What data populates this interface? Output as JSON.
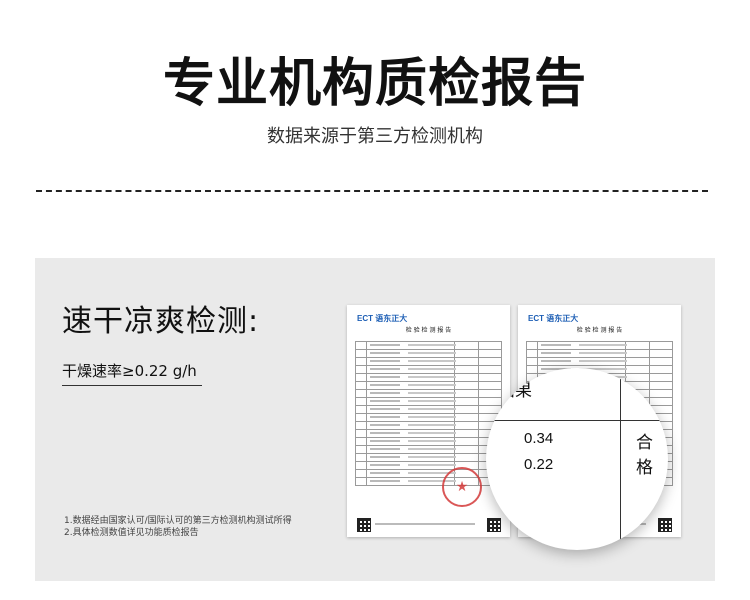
{
  "header": {
    "title": "专业机构质检报告",
    "subtitle": "数据来源于第三方检测机构"
  },
  "section": {
    "heading": "速干凉爽检测:",
    "rate_label": "干燥速率≥0.22 g/h",
    "footnotes": [
      "1.数据经由国家认可/国际认可的第三方检测机构测试所得",
      "2.具体检测数值详见功能质检报告"
    ]
  },
  "reports": {
    "logo_left": "ECT 语东正大",
    "logo_right": "ECT 语东正大",
    "title_left": "检 验 检 测 报 告",
    "title_right": "检 验 检 测 报 告"
  },
  "magnifier": {
    "result_label": "结果",
    "pass_label": "合格",
    "values": [
      "0.34",
      "0.22"
    ]
  },
  "colors": {
    "panel": "#eaeaea",
    "logo_blue": "#1e5fb5",
    "stamp_red": "#d43a3a"
  }
}
